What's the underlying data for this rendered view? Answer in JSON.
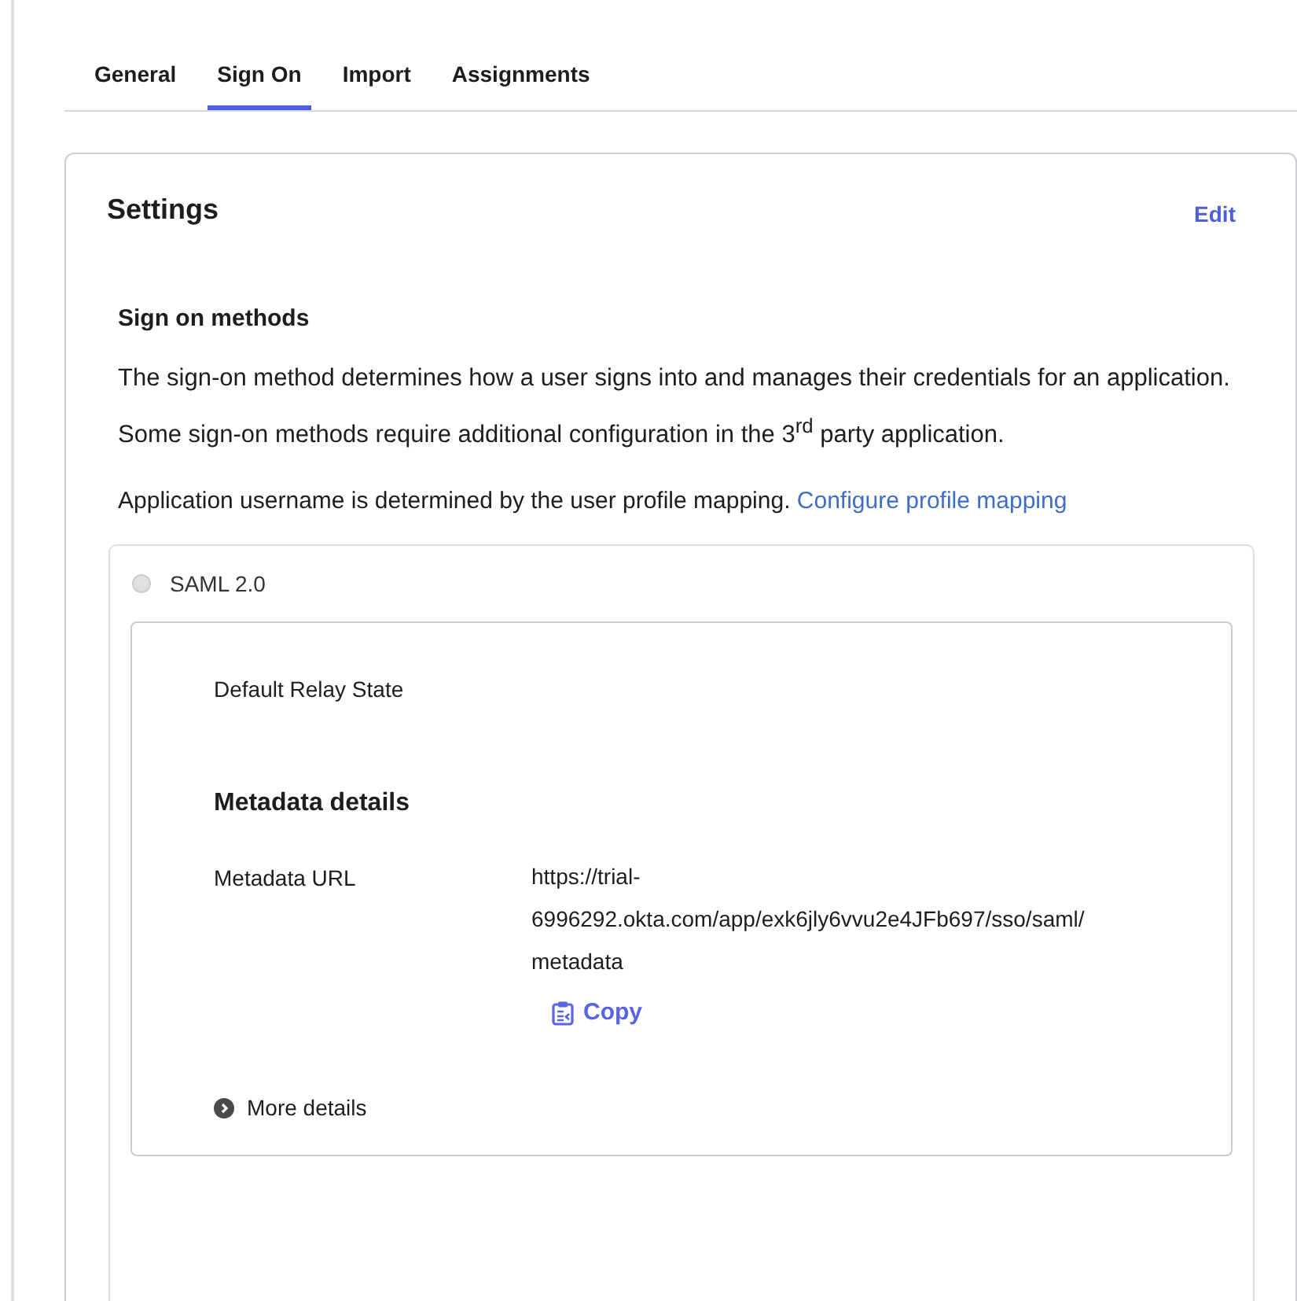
{
  "tabs": [
    {
      "label": "General",
      "selected": false
    },
    {
      "label": "Sign On",
      "selected": true
    },
    {
      "label": "Import",
      "selected": false
    },
    {
      "label": "Assignments",
      "selected": false
    }
  ],
  "settings": {
    "title": "Settings",
    "edit_link": "Edit",
    "section_title": "Sign on methods",
    "description": "The sign-on method determines how a user signs into and manages their credentials for an application. Some sign-on methods require additional configuration in the 3$^{rd}$ party application.",
    "username_note": "Application username is determined by the user profile mapping.",
    "username_link": "Configure profile mapping",
    "method": {
      "label": "SAML 2.0",
      "selected": false,
      "disabled": true,
      "relay_state_label": "Default Relay State",
      "metadata_title": "Metadata details",
      "metadata_url_label": "Metadata URL",
      "metadata_url_lines": [
        "https://trial-",
        "6996292.okta.com/app/exk6jly6vvu2e4JFb697/sso/saml/",
        "metadata"
      ],
      "copy_button": "Copy",
      "more_details": "More details",
      "more_details_expanded": false
    }
  }
}
